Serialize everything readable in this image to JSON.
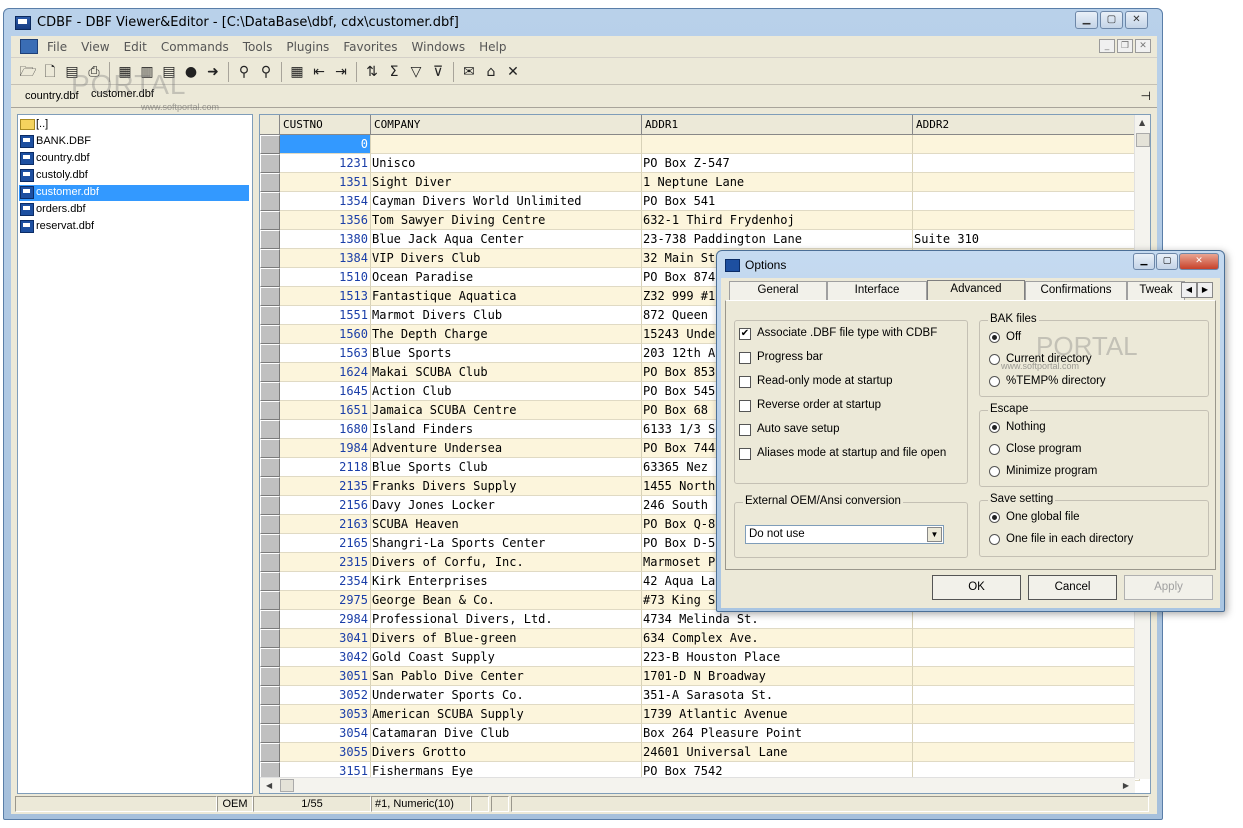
{
  "window": {
    "title": "CDBF - DBF Viewer&Editor - [C:\\DataBase\\dbf, cdx\\customer.dbf]"
  },
  "menu": [
    "File",
    "View",
    "Edit",
    "Commands",
    "Tools",
    "Plugins",
    "Favorites",
    "Windows",
    "Help"
  ],
  "doc_tabs": [
    "country.dbf",
    "customer.dbf"
  ],
  "watermark": {
    "logo": "PORTAL",
    "url": "www.softportal.com"
  },
  "files": [
    "[..]",
    "BANK.DBF",
    "country.dbf",
    "custoly.dbf",
    "customer.dbf",
    "orders.dbf",
    "reservat.dbf"
  ],
  "selected_file": "customer.dbf",
  "columns": [
    "CUSTNO",
    "COMPANY",
    "ADDR1",
    "ADDR2"
  ],
  "rows": [
    [
      "0",
      "",
      "",
      ""
    ],
    [
      "1231",
      "Unisco",
      "PO Box Z-547",
      ""
    ],
    [
      "1351",
      "Sight Diver",
      "1 Neptune Lane",
      ""
    ],
    [
      "1354",
      "Cayman Divers World Unlimited",
      "PO Box 541",
      ""
    ],
    [
      "1356",
      "Tom Sawyer Diving Centre",
      "632-1 Third Frydenhoj",
      ""
    ],
    [
      "1380",
      "Blue Jack Aqua Center",
      "23-738 Paddington Lane",
      "Suite 310"
    ],
    [
      "1384",
      "VIP Divers Club",
      "32 Main St",
      ""
    ],
    [
      "1510",
      "Ocean Paradise",
      "PO Box 874",
      ""
    ],
    [
      "1513",
      "Fantastique Aquatica",
      "Z32 999 #1",
      ""
    ],
    [
      "1551",
      "Marmot Divers Club",
      "872 Queen",
      ""
    ],
    [
      "1560",
      "The Depth Charge",
      "15243 Unde",
      ""
    ],
    [
      "1563",
      "Blue Sports",
      "203 12th A",
      ""
    ],
    [
      "1624",
      "Makai SCUBA Club",
      "PO Box 853",
      ""
    ],
    [
      "1645",
      "Action Club",
      "PO Box 545",
      ""
    ],
    [
      "1651",
      "Jamaica SCUBA Centre",
      "PO Box 68",
      ""
    ],
    [
      "1680",
      "Island Finders",
      "6133 1/3 S",
      ""
    ],
    [
      "1984",
      "Adventure Undersea",
      "PO Box 744",
      ""
    ],
    [
      "2118",
      "Blue Sports Club",
      "63365 Nez",
      ""
    ],
    [
      "2135",
      "Franks Divers Supply",
      "1455 North",
      ""
    ],
    [
      "2156",
      "Davy Jones Locker",
      "246 South",
      ""
    ],
    [
      "2163",
      "SCUBA Heaven",
      "PO Box Q-8",
      ""
    ],
    [
      "2165",
      "Shangri-La Sports Center",
      "PO Box D-5",
      ""
    ],
    [
      "2315",
      "Divers of Corfu, Inc.",
      "Marmoset P",
      ""
    ],
    [
      "2354",
      "Kirk Enterprises",
      "42 Aqua La",
      ""
    ],
    [
      "2975",
      "George Bean & Co.",
      "#73 King S",
      ""
    ],
    [
      "2984",
      "Professional Divers, Ltd.",
      "4734 Melinda St.",
      ""
    ],
    [
      "3041",
      "Divers of Blue-green",
      "634 Complex Ave.",
      ""
    ],
    [
      "3042",
      "Gold Coast Supply",
      "223-B Houston Place",
      ""
    ],
    [
      "3051",
      "San Pablo Dive Center",
      "1701-D N Broadway",
      ""
    ],
    [
      "3052",
      "Underwater Sports Co.",
      "351-A Sarasota St.",
      ""
    ],
    [
      "3053",
      "American SCUBA Supply",
      "1739 Atlantic Avenue",
      ""
    ],
    [
      "3054",
      "Catamaran Dive Club",
      "Box 264 Pleasure Point",
      ""
    ],
    [
      "3055",
      "Divers Grotto",
      "24601 Universal Lane",
      ""
    ],
    [
      "3151",
      "Fishermans Eye",
      "PO Box 7542",
      ""
    ]
  ],
  "status": {
    "encoding": "OEM",
    "position": "1/55",
    "field": "#1, Numeric(10)"
  },
  "dialog": {
    "title": "Options",
    "tabs": [
      "General",
      "Interface",
      "Advanced",
      "Confirmations",
      "Tweak"
    ],
    "active_tab": "Advanced",
    "checks": [
      {
        "label": "Associate .DBF file type with CDBF",
        "checked": true
      },
      {
        "label": "Progress bar",
        "checked": false
      },
      {
        "label": "Read-only mode at startup",
        "checked": false
      },
      {
        "label": "Reverse order at startup",
        "checked": false
      },
      {
        "label": "Auto save setup",
        "checked": false
      },
      {
        "label": "Aliases mode at startup and file open",
        "checked": false
      }
    ],
    "conversion": {
      "label": "External OEM/Ansi conversion",
      "value": "Do not use"
    },
    "bak": {
      "label": "BAK files",
      "options": [
        "Off",
        "Current directory",
        "%TEMP% directory"
      ],
      "selected": 0
    },
    "escape": {
      "label": "Escape",
      "options": [
        "Nothing",
        "Close program",
        "Minimize program"
      ],
      "selected": 0
    },
    "save": {
      "label": "Save setting",
      "options": [
        "One global file",
        "One file in each directory"
      ],
      "selected": 0
    },
    "buttons": {
      "ok": "OK",
      "cancel": "Cancel",
      "apply": "Apply"
    }
  }
}
